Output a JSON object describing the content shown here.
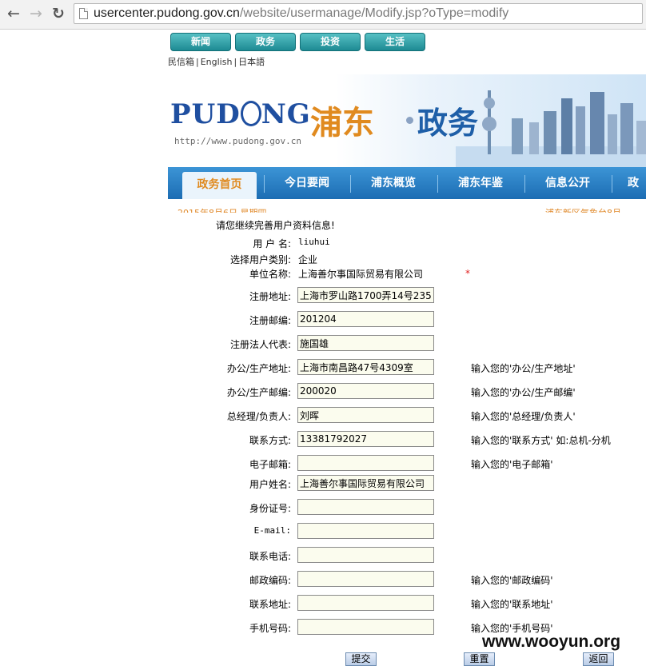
{
  "browser": {
    "url_host": "usercenter.pudong.gov.cn",
    "url_path": "/website/usermanage/Modify.jsp?oType=modify",
    "back_icon": "←",
    "forward_icon": "→",
    "reload_icon": "↻"
  },
  "top_nav": [
    {
      "label": "新闻"
    },
    {
      "label": "政务"
    },
    {
      "label": "投资"
    },
    {
      "label": "生活"
    }
  ],
  "sublinks": {
    "mailbox": "民信箱",
    "english": "English",
    "japanese": "日本語",
    "sep": "|"
  },
  "banner": {
    "logo_left": "PUD",
    "logo_right": "NG",
    "site_url": "http://www.pudong.gov.cn",
    "brush_title": "浦东",
    "gov_title": "政务"
  },
  "main_menu": [
    {
      "label": "政务首页",
      "active": true
    },
    {
      "label": "今日要闻"
    },
    {
      "label": "浦东概览"
    },
    {
      "label": "浦东年鉴"
    },
    {
      "label": "信息公开"
    },
    {
      "label": "政"
    }
  ],
  "date_strip": {
    "left": "2015年8月6日 星期四",
    "right": "浦东新区气象台8月"
  },
  "form": {
    "title": "请您继续完善用户资料信息!",
    "username_label": "用 户 名:",
    "username_value": "liuhui",
    "usertype_label": "选择用户类别:",
    "usertype_value": "企业",
    "company_label": "单位名称:",
    "company_value": "上海善尔事国际贸易有限公司",
    "required_mark": "*",
    "fields": {
      "reg_address": {
        "label": "注册地址:",
        "value": "上海市罗山路1700弄14号235"
      },
      "reg_postcode": {
        "label": "注册邮编:",
        "value": "201204"
      },
      "legal_rep": {
        "label": "注册法人代表:",
        "value": "施国雄"
      },
      "office_address": {
        "label": "办公/生产地址:",
        "value": "上海市南昌路47号4309室",
        "hint": "输入您的'办公/生产地址'"
      },
      "office_postcode": {
        "label": "办公/生产邮编:",
        "value": "200020",
        "hint": "输入您的'办公/生产邮编'"
      },
      "manager": {
        "label": "总经理/负责人:",
        "value": "刘晖",
        "hint": "输入您的'总经理/负责人'"
      },
      "contact": {
        "label": "联系方式:",
        "value": "13381792027",
        "hint": "输入您的'联系方式' 如:总机-分机"
      },
      "email_company": {
        "label": "电子邮箱:",
        "value": "",
        "hint": "输入您的'电子邮箱'"
      },
      "user_fullname": {
        "label": "用户姓名:",
        "value": "上海善尔事国际贸易有限公司"
      },
      "id_number": {
        "label": "身份证号:",
        "value": ""
      },
      "email": {
        "label": "E-mail:",
        "value": ""
      },
      "phone": {
        "label": "联系电话:",
        "value": ""
      },
      "postcode": {
        "label": "邮政编码:",
        "value": "",
        "hint": "输入您的'邮政编码'"
      },
      "address": {
        "label": "联系地址:",
        "value": "",
        "hint": "输入您的'联系地址'"
      },
      "mobile": {
        "label": "手机号码:",
        "value": "",
        "hint": "输入您的'手机号码'"
      }
    }
  },
  "buttons": {
    "submit": "提交",
    "reset": "重置",
    "back": "返回"
  },
  "watermark": "www.wooyun.org"
}
